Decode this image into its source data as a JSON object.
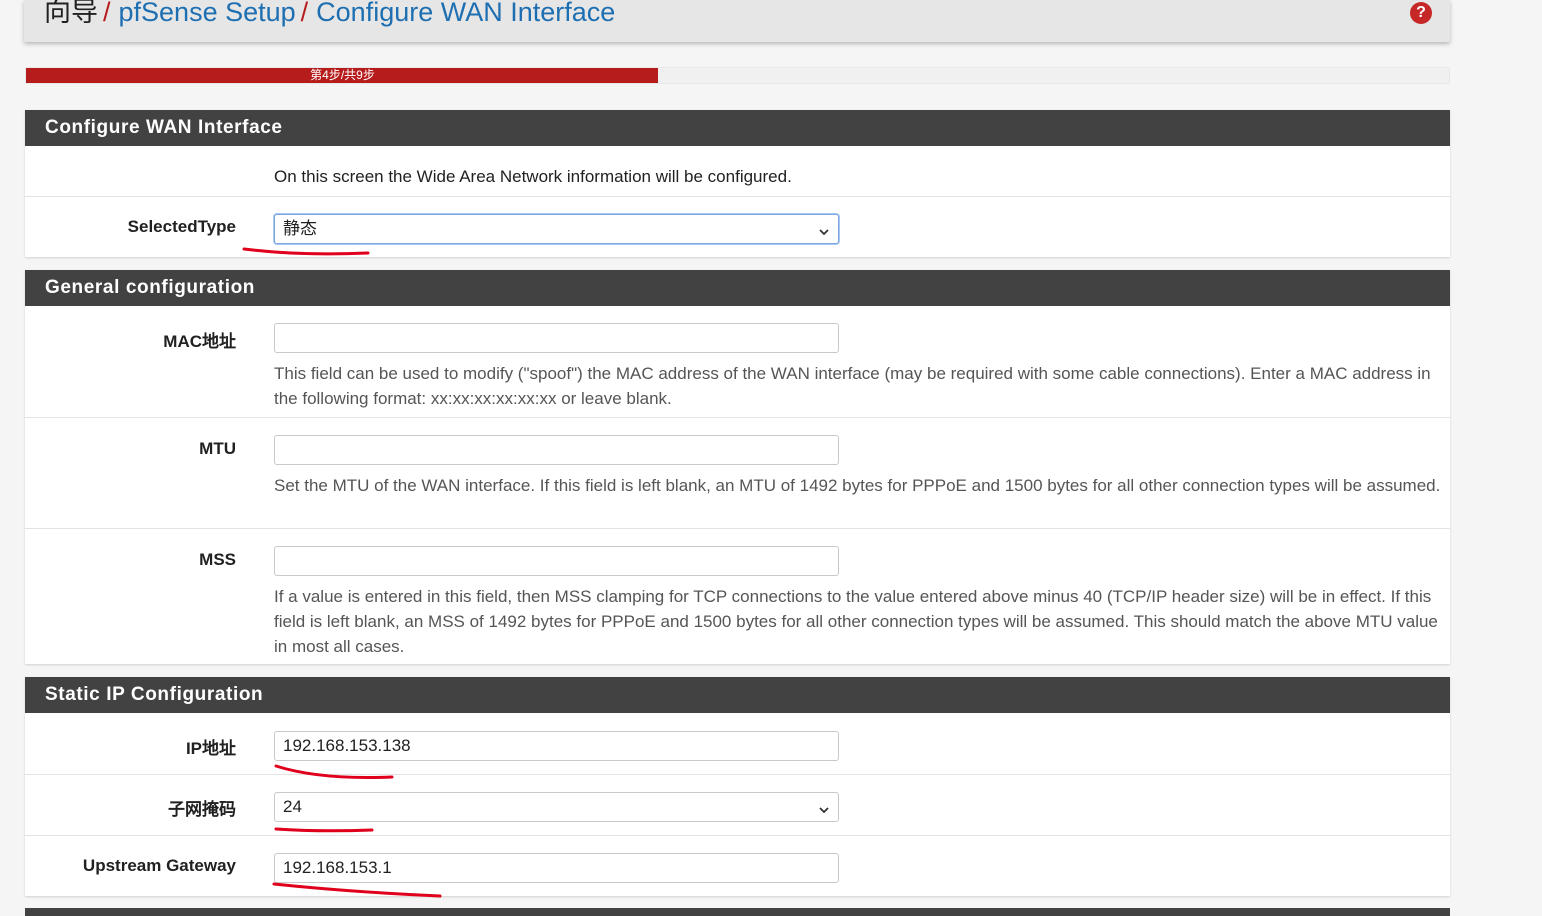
{
  "breadcrumb": {
    "root": "向导",
    "sep": "/",
    "item1": "pfSense Setup",
    "item2": "Configure WAN Interface"
  },
  "header": {
    "help_glyph": "?",
    "help_icon": "question-circle-icon"
  },
  "progress": {
    "label": "第4步/共9步",
    "current": 4,
    "total": 9
  },
  "panels": {
    "wan": {
      "title": "Configure WAN Interface",
      "intro": "On this screen the Wide Area Network information will be configured.",
      "selected_type_label": "SelectedType",
      "selected_type_value": "静态"
    },
    "general": {
      "title": "General configuration",
      "mac_label": "MAC地址",
      "mac_value": "",
      "mac_help": "This field can be used to modify (\"spoof\") the MAC address of the WAN interface (may be required with some cable connections). Enter a MAC address in the following format: xx:xx:xx:xx:xx:xx or leave blank.",
      "mtu_label": "MTU",
      "mtu_value": "",
      "mtu_help": "Set the MTU of the WAN interface. If this field is left blank, an MTU of 1492 bytes for PPPoE and 1500 bytes for all other connection types will be assumed.",
      "mss_label": "MSS",
      "mss_value": "",
      "mss_help": "If a value is entered in this field, then MSS clamping for TCP connections to the value entered above minus 40 (TCP/IP header size) will be in effect. If this field is left blank, an MSS of 1492 bytes for PPPoE and 1500 bytes for all other connection types will be assumed. This should match the above MTU value in most all cases."
    },
    "static": {
      "title": "Static IP Configuration",
      "ip_label": "IP地址",
      "ip_value": "192.168.153.138",
      "subnet_label": "子网掩码",
      "subnet_value": "24",
      "gateway_label": "Upstream Gateway",
      "gateway_value": "192.168.153.1"
    }
  },
  "colors": {
    "accent_red": "#b71c1c",
    "panel_header": "#424242",
    "link_blue": "#1e6fb2",
    "annotation_red": "#e0001b"
  }
}
